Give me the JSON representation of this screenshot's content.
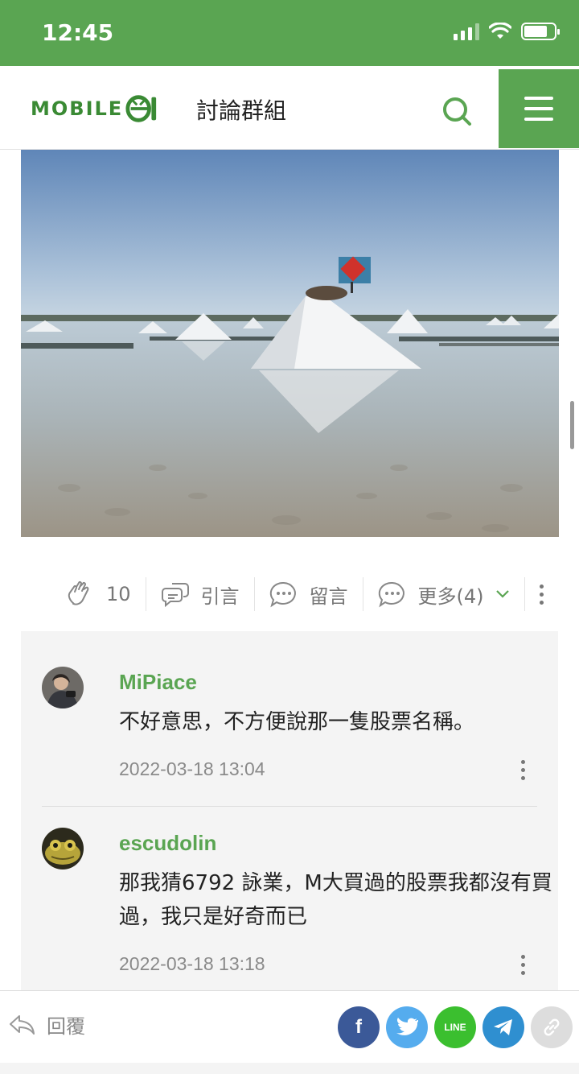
{
  "status_bar": {
    "time": "12:45"
  },
  "header": {
    "logo_text": "MOBILE",
    "logo_suffix": "01",
    "title": "討論群組"
  },
  "post": {
    "photo_caption": "",
    "actions": {
      "like_count": "10",
      "quote_label": "引言",
      "comment_label": "留言",
      "more_label": "更多(4)"
    }
  },
  "comments": [
    {
      "author": "MiPiace",
      "body": "不好意思，不方便說那一隻股票名稱。",
      "time": "2022-03-18 13:04"
    },
    {
      "author": "escudolin",
      "body": "那我猜6792 詠業，M大買過的股票我都沒有買過，我只是好奇而已",
      "time": "2022-03-18 13:18"
    }
  ],
  "bottom_bar": {
    "reply_label": "回覆",
    "share": {
      "facebook": "f",
      "line": "LINE"
    }
  },
  "colors": {
    "brand_green": "#5aa552",
    "facebook": "#3b5998",
    "twitter": "#55acee",
    "line": "#3bbf2f",
    "telegram": "#2f8fd0",
    "link": "#dddddd"
  }
}
